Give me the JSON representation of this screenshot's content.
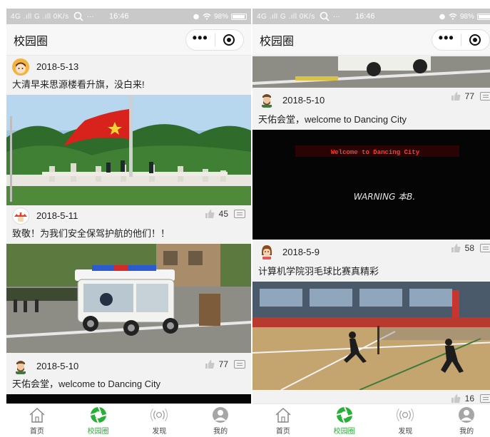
{
  "status": {
    "signal": "4G .ıll G .ıll 0K/s",
    "time": "16:46",
    "battery": "98%"
  },
  "header": {
    "title": "校园圈"
  },
  "tabs": [
    {
      "label": "首页",
      "icon": "home-icon",
      "active": false
    },
    {
      "label": "校园圈",
      "icon": "camera-aperture-icon",
      "active": true
    },
    {
      "label": "发现",
      "icon": "broadcast-icon",
      "active": false
    },
    {
      "label": "我的",
      "icon": "user-icon",
      "active": false
    }
  ],
  "colors": {
    "accent": "#27b036",
    "statusbar": "#c9c9c9",
    "background": "#f2f2f2"
  },
  "left": {
    "posts": [
      {
        "date": "2018-5-13",
        "text": "大清早来思源楼看升旗，没白来!",
        "likes": "",
        "image": "flag-raising-photo"
      },
      {
        "date": "2018-5-11",
        "text": "致敬！为我们安全保驾护航的他们！！",
        "likes": "45",
        "image": "security-cart-photo"
      },
      {
        "date": "2018-5-10",
        "text": "天佑会堂，welcome to Dancing City",
        "likes": "77",
        "image": "dark-hall-photo"
      }
    ]
  },
  "right": {
    "posts": [
      {
        "date": "",
        "text": "",
        "likes": "",
        "image": "security-cart-photo"
      },
      {
        "date": "2018-5-10",
        "text": "天佑会堂，welcome to Dancing City",
        "likes": "77",
        "image": "dark-hall-photo",
        "sign_text": "Welcome to Dancing City",
        "graffiti_text": "WARNING 本B."
      },
      {
        "date": "2018-5-9",
        "text": "计算机学院羽毛球比赛真精彩",
        "likes": "58",
        "image": "badminton-photo"
      },
      {
        "date": "",
        "text": "",
        "likes": "16",
        "image": ""
      }
    ]
  }
}
